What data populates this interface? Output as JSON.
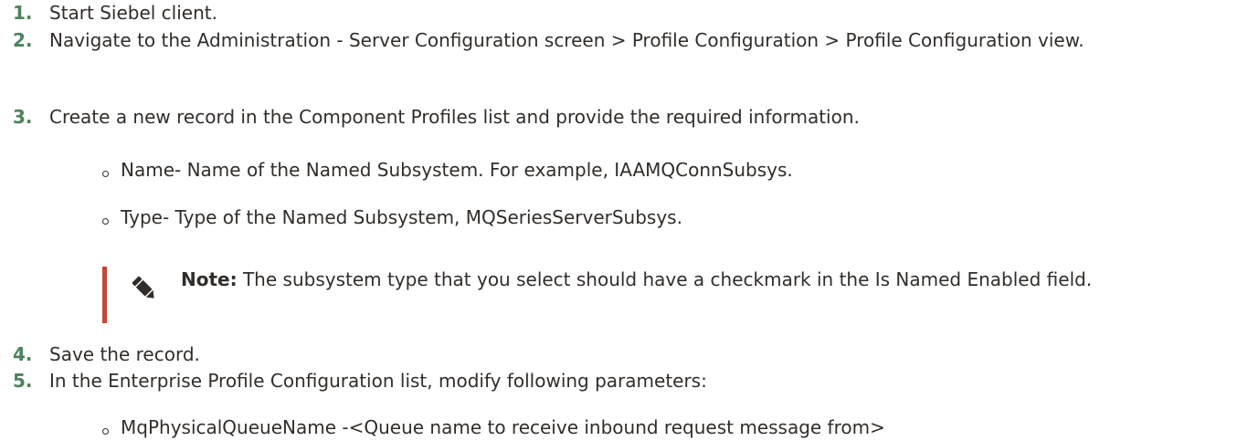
{
  "steps": [
    {
      "num": "1.",
      "text": "Start Siebel client."
    },
    {
      "num": "2.",
      "text": "Navigate to the Administration - Server Configuration screen > Profile Configuration > Profile Configuration view."
    },
    {
      "num": "3.",
      "text": "Create a new record in the Component Profiles list and provide the required information."
    },
    {
      "num": "4.",
      "text": "Save the record."
    },
    {
      "num": "5.",
      "text": "In the Enterprise Profile Configuration list, modify following parameters:"
    }
  ],
  "step3_bullets": [
    "Name- Name of the Named Subsystem. For example, IAAMQConnSubsys.",
    "Type- Type of the Named Subsystem, MQSeriesServerSubsys."
  ],
  "note": {
    "label": "Note:",
    "text": "The subsystem type that you select should have a checkmark in the Is Named Enabled field.",
    "icon": "pencil-icon"
  },
  "step5_bullets": [
    "MqPhysicalQueueName -<Queue name to receive inbound request message from>"
  ],
  "colors": {
    "step_number": "#4c825c",
    "note_bar": "#c74634",
    "text": "#312d2a"
  }
}
